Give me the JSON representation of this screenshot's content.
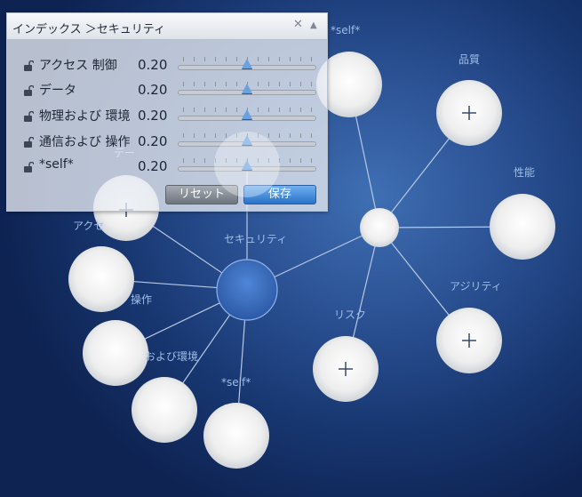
{
  "panel": {
    "title": "インデックス ＞セキュリティ",
    "close_icon": "close-icon",
    "collapse_icon": "collapse-up-icon",
    "rows": [
      {
        "label": "アクセス 制御",
        "value": "0.20",
        "slider": 0.5
      },
      {
        "label": "データ",
        "value": "0.20",
        "slider": 0.5
      },
      {
        "label": "物理および 環境",
        "value": "0.20",
        "slider": 0.5
      },
      {
        "label": "通信および 操作",
        "value": "0.20",
        "slider": 0.5
      },
      {
        "label": "*self*",
        "value": "0.20",
        "slider": 0.5
      }
    ],
    "reset_label": "リセット",
    "save_label": "保存"
  },
  "graph": {
    "labels": {
      "self_top": "*self*",
      "quality": "品質",
      "performance": "性能",
      "agility": "アジリティ",
      "risk": "リスク",
      "security": "セキュリティ",
      "access": "アクセ",
      "comm_ops": "操作",
      "phys_env": "および環境",
      "self_bottom": "*self*",
      "data_partial": "デー"
    }
  },
  "colors": {
    "background": "#173670",
    "node_fill": "#f2f2f2",
    "security_node": "#3a6bbf",
    "accent_button": "#2a72c8"
  }
}
